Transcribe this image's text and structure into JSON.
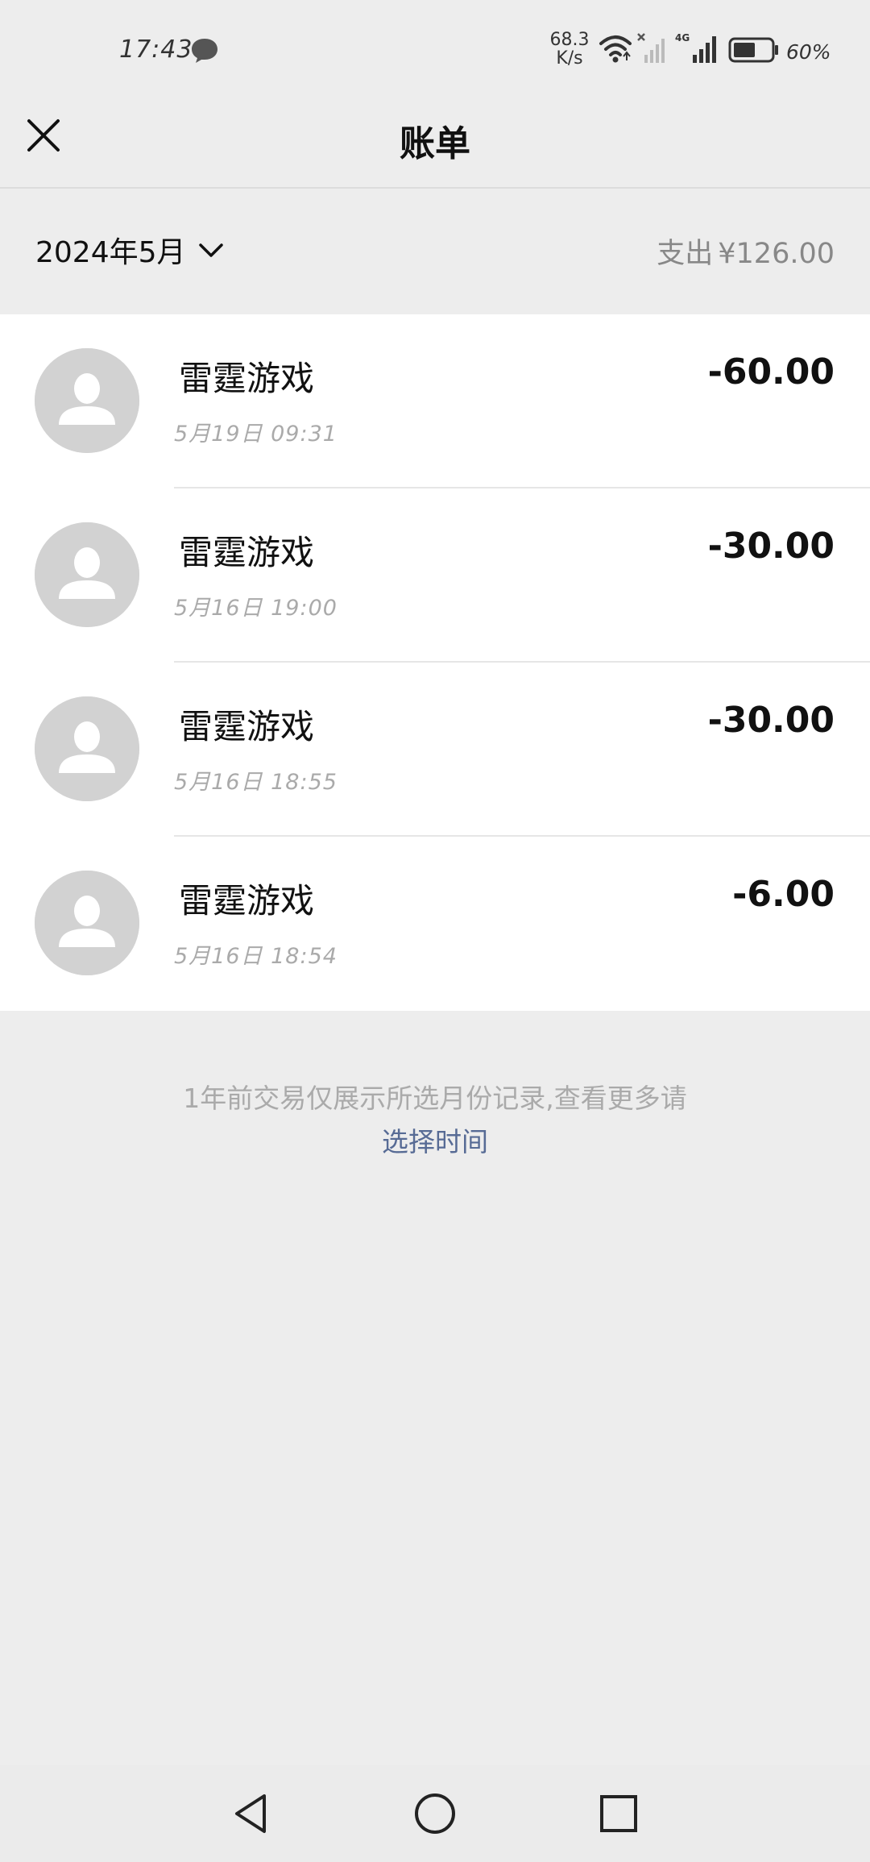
{
  "status_bar": {
    "time": "17:43",
    "net_speed_value": "68.3",
    "net_speed_unit": "K/s",
    "sim2_network": "4G",
    "battery_percent": "60%",
    "battery_level": 0.6,
    "icons": [
      "chat-bubble-icon",
      "wifi-icon",
      "signal-off-icon",
      "signal-icon",
      "battery-icon"
    ]
  },
  "header": {
    "title": "账单",
    "close_icon": "close-icon"
  },
  "filter": {
    "month": "2024年5月",
    "expense_label": "支出",
    "expense_amount": "¥126.00"
  },
  "bills": [
    {
      "name": "雷霆游戏",
      "time": "5月19日  09:31",
      "amount": "-60.00"
    },
    {
      "name": "雷霆游戏",
      "time": "5月16日  19:00",
      "amount": "-30.00"
    },
    {
      "name": "雷霆游戏",
      "time": "5月16日  18:55",
      "amount": "-30.00"
    },
    {
      "name": "雷霆游戏",
      "time": "5月16日  18:54",
      "amount": "-6.00"
    }
  ],
  "footer": {
    "note": "1年前交易仅展示所选月份记录,查看更多请",
    "link": "选择时间"
  },
  "colors": {
    "background": "#ededed",
    "card": "#ffffff",
    "link": "#576b95",
    "avatar": "#d2d2d2",
    "secondary_text": "#aaaaaa"
  },
  "system_nav": [
    "back-icon",
    "home-icon",
    "recents-icon"
  ]
}
